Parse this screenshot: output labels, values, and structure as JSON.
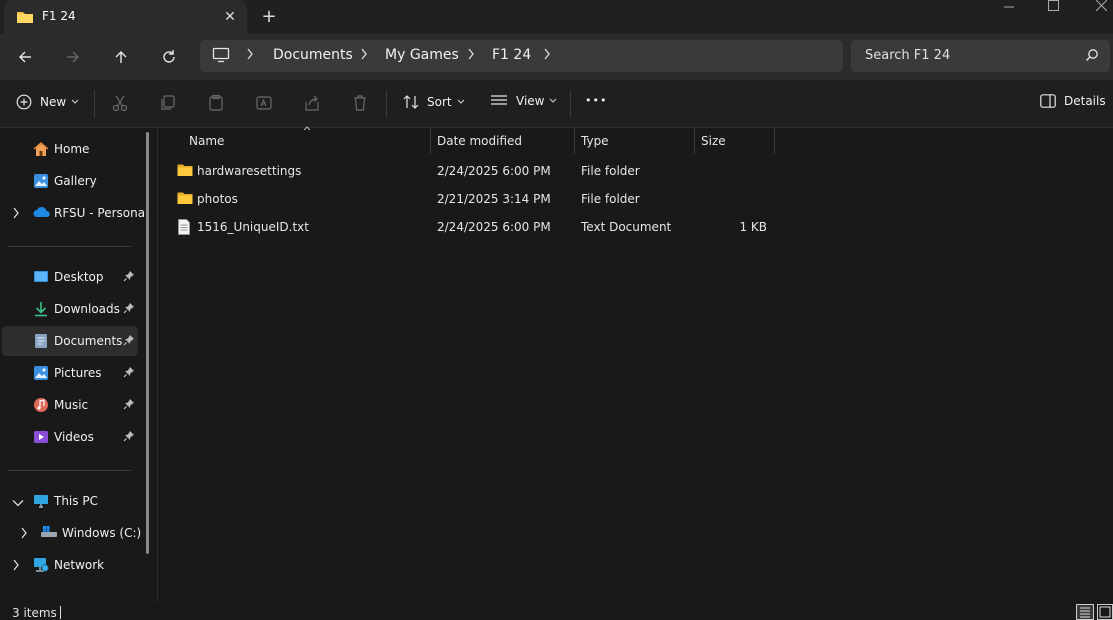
{
  "window": {
    "tab_title": "F1 24",
    "tab_close": "✕",
    "new_tab": "+"
  },
  "nav": {
    "breadcrumbs": [
      "Documents",
      "My Games",
      "F1 24"
    ],
    "search_placeholder": "Search F1 24"
  },
  "commands": {
    "new_label": "New",
    "sort_label": "Sort",
    "view_label": "View",
    "more_label": "•••",
    "details_label": "Details"
  },
  "sidebar": {
    "items": [
      {
        "label": "Home",
        "icon": "home-icon"
      },
      {
        "label": "Gallery",
        "icon": "gallery-icon"
      },
      {
        "label": "RFSU - Personal",
        "icon": "onedrive-icon"
      },
      {
        "label": "Desktop",
        "icon": "desktop-icon"
      },
      {
        "label": "Downloads",
        "icon": "download-icon"
      },
      {
        "label": "Documents",
        "icon": "documents-icon"
      },
      {
        "label": "Pictures",
        "icon": "pictures-icon"
      },
      {
        "label": "Music",
        "icon": "music-icon"
      },
      {
        "label": "Videos",
        "icon": "videos-icon"
      },
      {
        "label": "This PC",
        "icon": "pc-icon"
      },
      {
        "label": "Windows (C:)",
        "icon": "drive-icon"
      },
      {
        "label": "Network",
        "icon": "network-icon"
      }
    ]
  },
  "table": {
    "columns": [
      "Name",
      "Date modified",
      "Type",
      "Size"
    ],
    "rows": [
      {
        "name": "hardwaresettings",
        "date": "2/24/2025 6:00 PM",
        "type": "File folder",
        "size": "",
        "icon": "folder-icon"
      },
      {
        "name": "photos",
        "date": "2/21/2025 3:14 PM",
        "type": "File folder",
        "size": "",
        "icon": "folder-icon"
      },
      {
        "name": "1516_UniqueID.txt",
        "date": "2/24/2025 6:00 PM",
        "type": "Text Document",
        "size": "1 KB",
        "icon": "text-file-icon"
      }
    ]
  },
  "status": {
    "items_count": "3 items"
  },
  "colors": {
    "folder": "#f4c542",
    "accent": "#4cc2ff",
    "background": "#191919"
  }
}
